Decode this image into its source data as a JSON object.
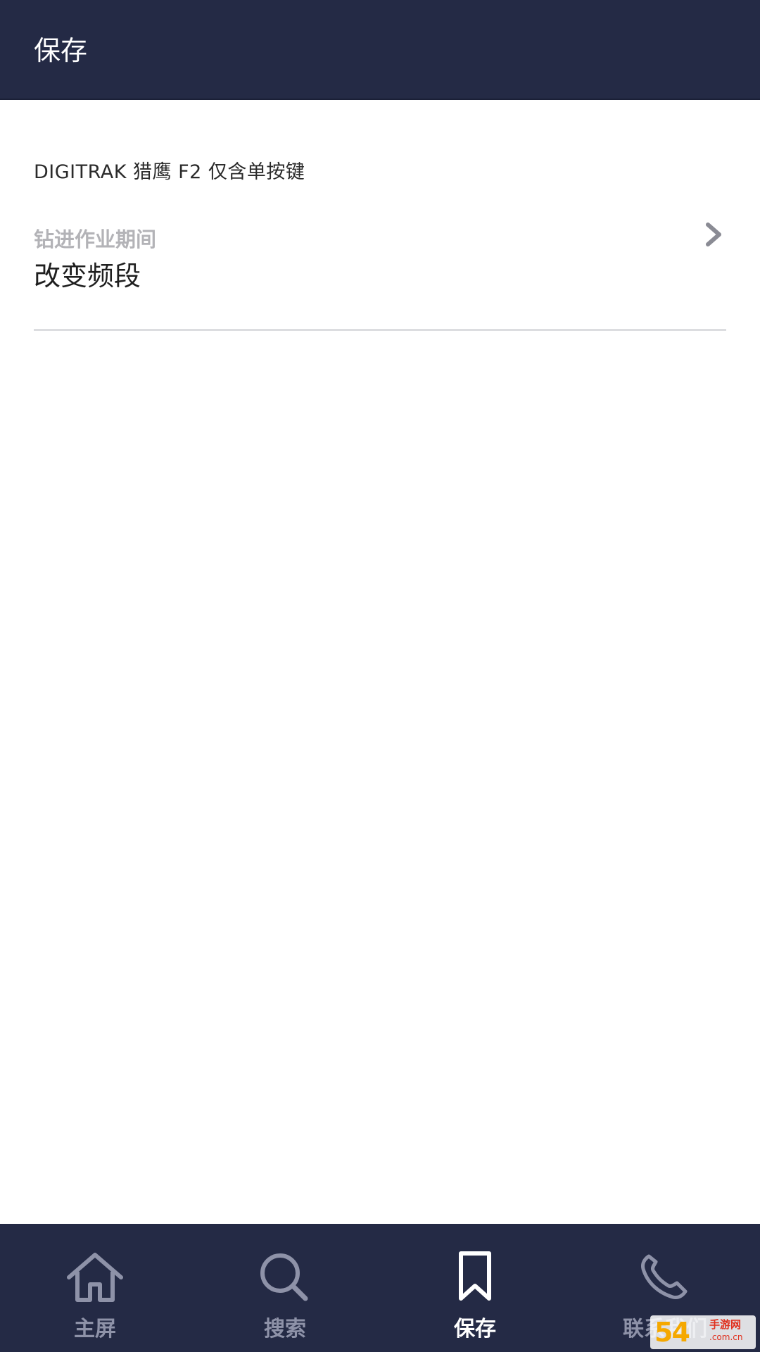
{
  "app_bar": {
    "title": "保存"
  },
  "content": {
    "section_header": "DIGITRAK 猎鹰 F2 仅含单按键",
    "items": [
      {
        "subtitle": "钻进作业期间",
        "title": "改变频段",
        "trailing_icon": "chevron-right-icon"
      }
    ]
  },
  "bottom_nav": {
    "tabs": [
      {
        "label": "主屏",
        "icon": "home-icon",
        "active": false
      },
      {
        "label": "搜索",
        "icon": "search-icon",
        "active": false
      },
      {
        "label": "保存",
        "icon": "bookmark-icon",
        "active": true
      },
      {
        "label": "联系我们",
        "icon": "phone-icon",
        "active": false
      }
    ]
  },
  "watermark": {
    "number": "54",
    "text": "手游网",
    "domain": ".com.cn"
  },
  "colors": {
    "bar_background": "#242a45",
    "nav_inactive": "#8e92a8",
    "nav_active": "#ffffff",
    "subtitle": "#b3b3b7",
    "divider": "#dcdde0"
  }
}
